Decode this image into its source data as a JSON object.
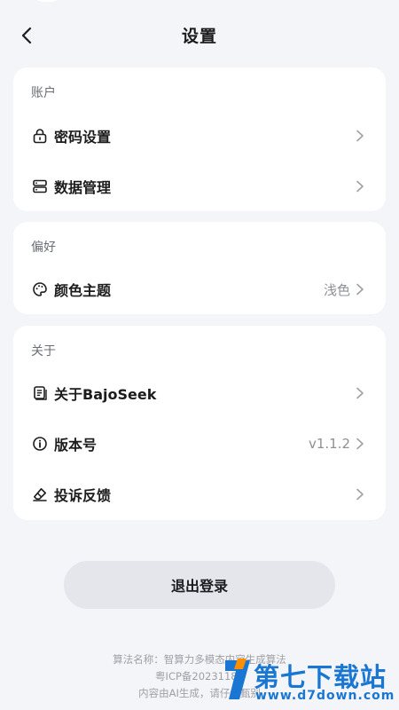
{
  "header": {
    "title": "设置"
  },
  "sections": {
    "account": {
      "label": "账户",
      "items": [
        {
          "label": "密码设置",
          "icon": "lock-icon"
        },
        {
          "label": "数据管理",
          "icon": "storage-icon"
        }
      ]
    },
    "preference": {
      "label": "偏好",
      "items": [
        {
          "label": "颜色主题",
          "value": "浅色",
          "icon": "palette-icon"
        }
      ]
    },
    "about": {
      "label": "关于",
      "items": [
        {
          "label": "关于BajoSeek",
          "icon": "document-icon"
        },
        {
          "label": "版本号",
          "value": "v1.1.2",
          "icon": "info-icon"
        },
        {
          "label": "投诉反馈",
          "icon": "eraser-icon"
        }
      ]
    }
  },
  "logout": {
    "label": "退出登录"
  },
  "footer": {
    "line1": "算法名称：智算力多模态内容生成算法",
    "line2": "粤ICP备20231184",
    "line3": "内容由AI生成，请仔细甄别"
  },
  "watermark": {
    "title": "第七下载站",
    "url": "www.d7down.com"
  },
  "colors": {
    "background": "#f4f5f8",
    "card": "#ffffff",
    "button": "#e4e6ec",
    "watermark": "#1976d2"
  }
}
